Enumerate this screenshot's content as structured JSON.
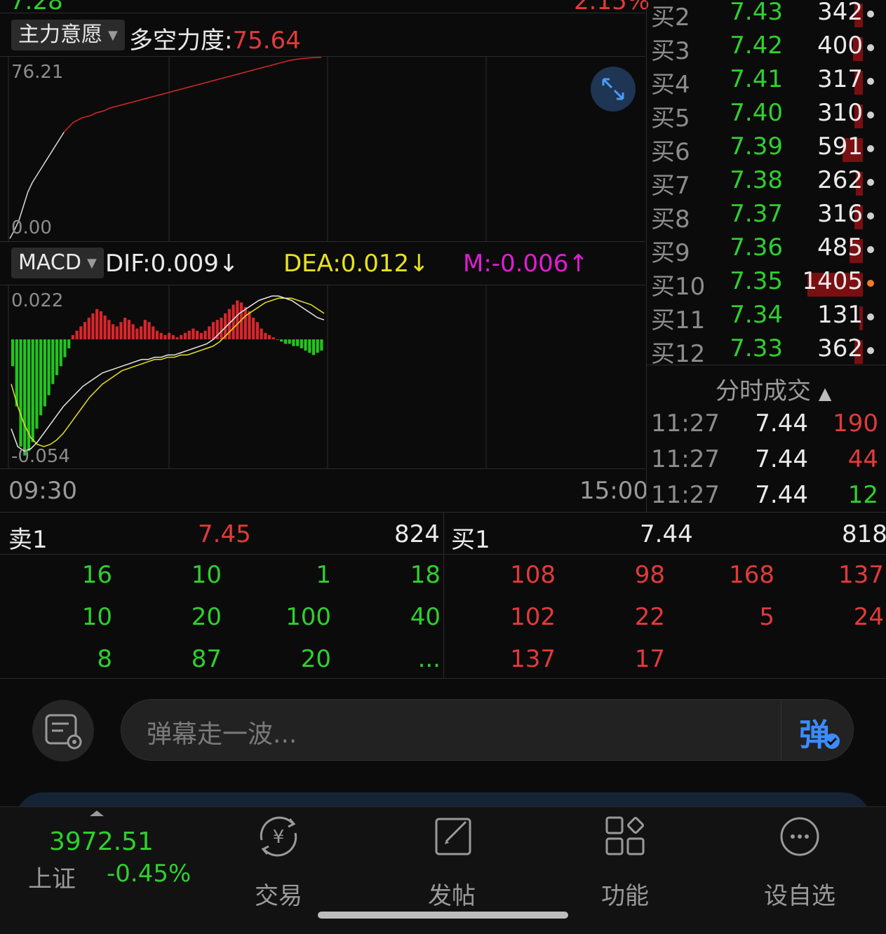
{
  "header": {
    "clipped_left_value": "7.28",
    "clipped_right_value": "2.15%"
  },
  "power_panel": {
    "dropdown_label": "主力意愿",
    "title_label": "多空力度:",
    "title_value": "75.64",
    "y_max": "76.21",
    "y_min": "0.00",
    "series": [
      0.5,
      4,
      8,
      14,
      20,
      24,
      27,
      30,
      33,
      36,
      39,
      42,
      45,
      47,
      49,
      50,
      51,
      51.5,
      52,
      53,
      53.5,
      54,
      55,
      55.5,
      56,
      56.5,
      57,
      57.5,
      58,
      58.5,
      59,
      59.5,
      60,
      60.5,
      61,
      61.5,
      62,
      62.5,
      63,
      63.5,
      64,
      64.5,
      65,
      65.5,
      66,
      66.5,
      67,
      67.5,
      68,
      68.5,
      69,
      69.5,
      70,
      70.5,
      71,
      71.5,
      72,
      72.5,
      73,
      73.5,
      74,
      74.5,
      75,
      75.3,
      75.6,
      75.8,
      76,
      76.1,
      76.21,
      76.2
    ]
  },
  "macd_panel": {
    "dropdown_label": "MACD",
    "dif_text": "DIF:0.009↓",
    "dea_text": "DEA:0.012↓",
    "m_text": "M:-0.006↑",
    "y_max": "0.022",
    "y_min": "-0.054",
    "time_start": "09:30",
    "time_end": "15:00",
    "hist": [
      -0.012,
      -0.03,
      -0.048,
      -0.052,
      -0.05,
      -0.046,
      -0.04,
      -0.034,
      -0.03,
      -0.025,
      -0.02,
      -0.016,
      -0.012,
      -0.008,
      -0.004,
      0.002,
      0.004,
      0.006,
      0.008,
      0.01,
      0.012,
      0.014,
      0.013,
      0.011,
      0.009,
      0.007,
      0.006,
      0.008,
      0.01,
      0.009,
      0.007,
      0.005,
      0.006,
      0.009,
      0.008,
      0.006,
      0.004,
      0.003,
      0.002,
      0.003,
      0.002,
      0.001,
      0.002,
      0.003,
      0.004,
      0.005,
      0.004,
      0.003,
      0.004,
      0.006,
      0.008,
      0.009,
      0.01,
      0.012,
      0.014,
      0.016,
      0.018,
      0.017,
      0.015,
      0.013,
      0.01,
      0.008,
      0.005,
      0.003,
      0.002,
      0.001,
      0.0,
      -0.001,
      -0.002,
      -0.002,
      -0.003,
      -0.003,
      -0.004,
      -0.005,
      -0.006,
      -0.007,
      -0.006,
      -0.005
    ],
    "dif": [
      -0.04,
      -0.048,
      -0.05,
      -0.049,
      -0.046,
      -0.042,
      -0.038,
      -0.034,
      -0.03,
      -0.027,
      -0.024,
      -0.021,
      -0.019,
      -0.017,
      -0.015,
      -0.014,
      -0.013,
      -0.012,
      -0.011,
      -0.01,
      -0.009,
      -0.009,
      -0.008,
      -0.008,
      -0.007,
      -0.007,
      -0.006,
      -0.005,
      -0.004,
      -0.003,
      -0.002,
      0.0,
      0.003,
      0.006,
      0.009,
      0.012,
      0.014,
      0.016,
      0.018,
      0.019,
      0.02,
      0.02,
      0.019,
      0.018,
      0.016,
      0.014,
      0.012,
      0.01,
      0.009
    ],
    "dea": [
      -0.02,
      -0.03,
      -0.038,
      -0.044,
      -0.047,
      -0.048,
      -0.047,
      -0.045,
      -0.042,
      -0.038,
      -0.034,
      -0.03,
      -0.026,
      -0.023,
      -0.02,
      -0.018,
      -0.016,
      -0.014,
      -0.013,
      -0.012,
      -0.011,
      -0.01,
      -0.009,
      -0.009,
      -0.008,
      -0.008,
      -0.007,
      -0.007,
      -0.006,
      -0.005,
      -0.004,
      -0.003,
      -0.001,
      0.002,
      0.005,
      0.008,
      0.011,
      0.013,
      0.015,
      0.017,
      0.018,
      0.019,
      0.019,
      0.019,
      0.018,
      0.017,
      0.016,
      0.014,
      0.012
    ]
  },
  "order_book": {
    "buy_levels": [
      {
        "label": "买2",
        "price": "7.43",
        "volume": "342",
        "bar": 0.05,
        "dot": "#cfcfcf"
      },
      {
        "label": "买3",
        "price": "7.42",
        "volume": "400",
        "bar": 0.06,
        "dot": "#cfcfcf"
      },
      {
        "label": "买4",
        "price": "7.41",
        "volume": "317",
        "bar": 0.05,
        "dot": "#cfcfcf"
      },
      {
        "label": "买5",
        "price": "7.40",
        "volume": "310",
        "bar": 0.05,
        "dot": "#cfcfcf"
      },
      {
        "label": "买6",
        "price": "7.39",
        "volume": "591",
        "bar": 0.12,
        "dot": "#cfcfcf"
      },
      {
        "label": "买7",
        "price": "7.38",
        "volume": "262",
        "bar": 0.04,
        "dot": "#cfcfcf"
      },
      {
        "label": "买8",
        "price": "7.37",
        "volume": "316",
        "bar": 0.05,
        "dot": "#cfcfcf"
      },
      {
        "label": "买9",
        "price": "7.36",
        "volume": "485",
        "bar": 0.08,
        "dot": "#cfcfcf"
      },
      {
        "label": "买10",
        "price": "7.35",
        "volume": "1405",
        "bar": 0.33,
        "dot": "#f07a2a"
      },
      {
        "label": "买11",
        "price": "7.34",
        "volume": "131",
        "bar": 0.02,
        "dot": "#cfcfcf"
      },
      {
        "label": "买12",
        "price": "7.33",
        "volume": "362",
        "bar": 0.05,
        "dot": "#cfcfcf"
      }
    ],
    "trades_header": "分时成交",
    "trades": [
      {
        "time": "11:27",
        "price": "7.44",
        "volume": "190",
        "color": "red"
      },
      {
        "time": "11:27",
        "price": "7.44",
        "volume": "44",
        "color": "red"
      },
      {
        "time": "11:27",
        "price": "7.44",
        "volume": "12",
        "color": "green"
      }
    ]
  },
  "queue": {
    "sell_label": "卖1",
    "sell_price": "7.45",
    "sell_volume": "824",
    "buy_label": "买1",
    "buy_price": "7.44",
    "buy_volume": "818",
    "sell_rows": [
      [
        "16",
        "10",
        "1",
        "18"
      ],
      [
        "10",
        "20",
        "100",
        "40"
      ],
      [
        "8",
        "87",
        "20",
        "..."
      ]
    ],
    "buy_rows": [
      [
        "108",
        "98",
        "168",
        "137"
      ],
      [
        "102",
        "22",
        "5",
        "24"
      ],
      [
        "137",
        "17",
        "",
        ""
      ]
    ]
  },
  "comment_bar": {
    "placeholder": "弹幕走一波...",
    "danmaku_char": "弹"
  },
  "bottom_nav": {
    "index_value": "3972.51",
    "index_name": "上证",
    "index_change": "-0.45%",
    "items": [
      {
        "label": "交易",
        "icon": "yuan-exchange-icon"
      },
      {
        "label": "发帖",
        "icon": "edit-post-icon"
      },
      {
        "label": "功能",
        "icon": "function-grid-icon"
      },
      {
        "label": "设自选",
        "icon": "more-dots-icon"
      }
    ]
  }
}
